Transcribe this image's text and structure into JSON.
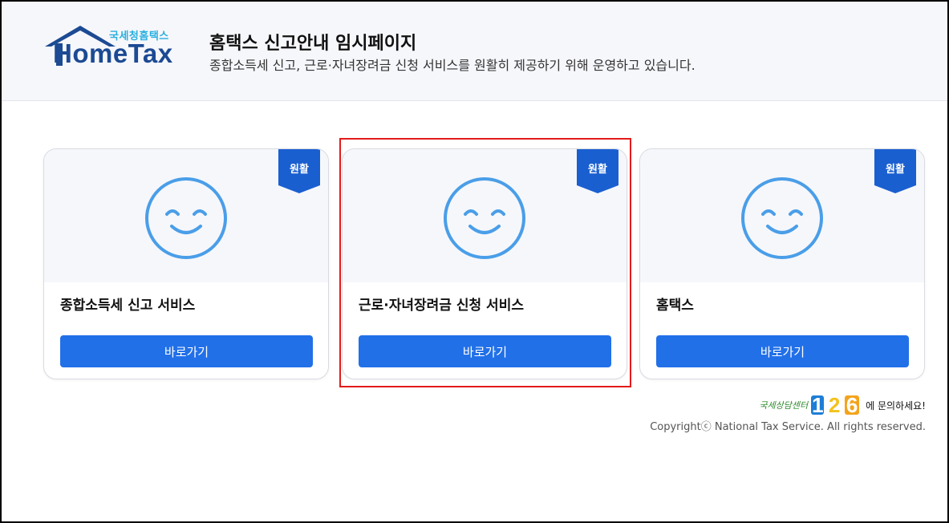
{
  "header": {
    "logo_sub": "국세청홈택스",
    "logo_main": "HomeTax",
    "title": "홈택스 신고안내 임시페이지",
    "subtitle": "종합소득세 신고, 근로·자녀장려금 신청 서비스를 원활히 제공하기 위해 운영하고 있습니다."
  },
  "cards": [
    {
      "badge": "원활",
      "title": "종합소득세 신고 서비스",
      "button": "바로가기",
      "icon": "smile-icon"
    },
    {
      "badge": "원활",
      "title": "근로·자녀장려금 신청 서비스",
      "button": "바로가기",
      "icon": "smile-icon"
    },
    {
      "badge": "원활",
      "title": "홈택스",
      "button": "바로가기",
      "icon": "smile-icon"
    }
  ],
  "footer": {
    "contact_label": "국세상담센터",
    "contact_digits": [
      "1",
      "2",
      "6"
    ],
    "contact_suffix": "에 문의하세요!",
    "copyright": "Copyrightⓒ National Tax Service. All rights reserved."
  },
  "colors": {
    "accent": "#2170e8",
    "badge": "#1a5fd0",
    "highlight": "#e41b1b",
    "smile": "#4a9ee8"
  }
}
